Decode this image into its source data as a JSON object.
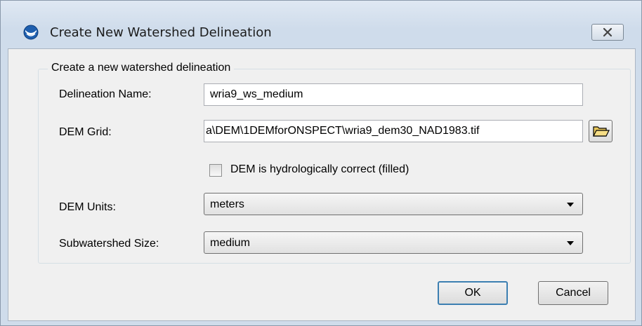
{
  "window": {
    "title": "Create New Watershed Delineation"
  },
  "group": {
    "legend": "Create a new watershed delineation"
  },
  "fields": {
    "delineation_name": {
      "label": "Delineation Name:",
      "value": "wria9_ws_medium"
    },
    "dem_grid": {
      "label": "DEM Grid:",
      "value": "a\\DEM\\1DEMforONSPECT\\wria9_dem30_NAD1983.tif"
    },
    "hydro_correct": {
      "label": "DEM is hydrologically correct (filled)",
      "checked": false
    },
    "dem_units": {
      "label": "DEM Units:",
      "selected": "meters"
    },
    "subwatershed_size": {
      "label": "Subwatershed Size:",
      "selected": "medium"
    }
  },
  "buttons": {
    "ok": "OK",
    "cancel": "Cancel"
  },
  "icons": {
    "app": "noaa-logo-icon",
    "close": "close-icon",
    "browse": "folder-open-icon",
    "dropdown": "chevron-down-icon"
  },
  "colors": {
    "titlebar": "#cfdceb",
    "client": "#f0f0f0",
    "default_button_border": "#3c7fb1"
  }
}
